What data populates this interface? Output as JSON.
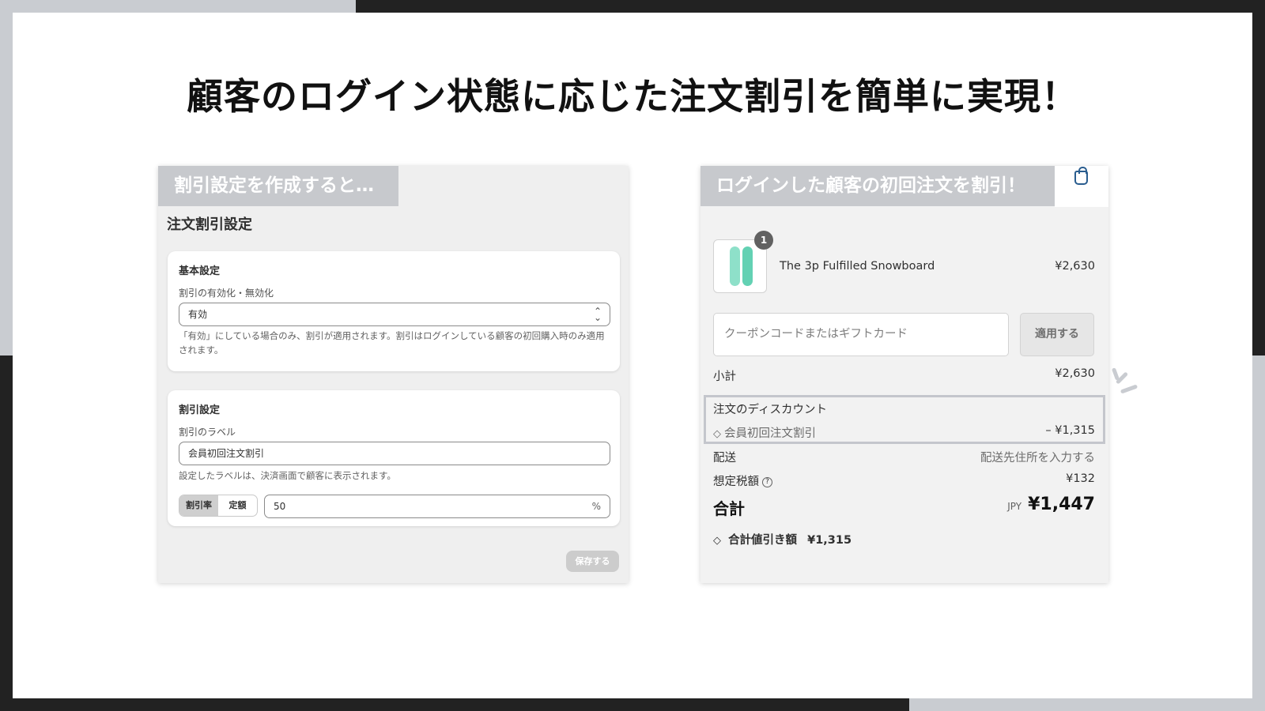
{
  "headline": "顧客のログイン状態に応じた注文割引を簡単に実現！",
  "left_panel": {
    "tag": "割引設定を作成すると…",
    "title": "注文割引設定",
    "basic": {
      "heading": "基本設定",
      "enable_label": "割引の有効化・無効化",
      "enable_value": "有効",
      "help": "「有効」にしている場合のみ、割引が適用されます。割引はログインしている顧客の初回購入時のみ適用されます。"
    },
    "discount": {
      "heading": "割引設定",
      "label_label": "割引のラベル",
      "label_value": "会員初回注文割引",
      "label_help": "設定したラベルは、決済画面で顧客に表示されます。",
      "type_options": [
        "割引率",
        "定額"
      ],
      "type_selected": "割引率",
      "amount_value": "50",
      "amount_suffix": "%"
    },
    "save_label": "保存する"
  },
  "right_panel": {
    "tag": "ログインした顧客の初回注文を割引！",
    "bag_icon": "shopping-bag-icon",
    "product": {
      "name": "The 3p Fulfilled Snowboard",
      "price": "¥2,630",
      "quantity": "1"
    },
    "coupon_placeholder": "クーポンコードまたはギフトカード",
    "apply_label": "適用する",
    "subtotal_label": "小計",
    "subtotal_value": "¥2,630",
    "order_discount_label": "注文のディスカウント",
    "discount_name": "会員初回注文割引",
    "discount_value": "– ¥1,315",
    "shipping_label": "配送",
    "shipping_value": "配送先住所を入力する",
    "tax_label": "想定税額",
    "tax_value": "¥132",
    "total_label": "合計",
    "total_currency": "JPY",
    "total_value": "¥1,447",
    "savings_label": "合計値引き額",
    "savings_value": "¥1,315"
  },
  "colors": {
    "tag_bg": "#c7c9cd",
    "dark_frame": "#222222",
    "gray_frame": "#c9ccd1",
    "bag_icon": "#2a5d8f",
    "board": "#63d1b3"
  }
}
